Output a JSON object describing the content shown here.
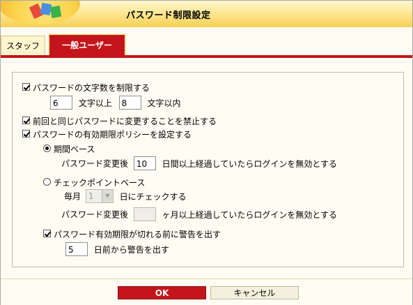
{
  "window": {
    "title": "パスワード制限設定"
  },
  "tabs": [
    {
      "label": "スタッフ"
    },
    {
      "label": "一般ユーザー"
    }
  ],
  "length_limit": {
    "label": "パスワードの文字数を制限する",
    "checked": true,
    "min": "6",
    "min_suffix": "文字以上",
    "max": "8",
    "max_suffix": "文字以内"
  },
  "reuse": {
    "label": "前回と同じパスワードに変更することを禁止する",
    "checked": true
  },
  "expiry": {
    "label": "パスワードの有効期限ポリシーを設定する",
    "checked": true,
    "period": {
      "label": "期間ベース",
      "selected": true,
      "prefix": "パスワード変更後",
      "days": "10",
      "suffix": "日間以上経過していたらログインを無効とする"
    },
    "checkpoint": {
      "label": "チェックポイントベース",
      "selected": false,
      "monthly_prefix": "毎月",
      "day": "1",
      "day_suffix": "日にチェックする",
      "prefix": "パスワード変更後",
      "months": "",
      "suffix": "ヶ月以上経過していたらログインを無効とする"
    },
    "warning": {
      "label": "パスワード有効期限が切れる前に警告を出す",
      "checked": true,
      "days": "5",
      "suffix": "日前から警告を出す"
    }
  },
  "buttons": {
    "ok": "OK",
    "cancel": "キャンセル"
  },
  "colors": {
    "accent": "#c3151b",
    "title_bar": "#fde489",
    "panel_bg": "#fffdf3"
  }
}
